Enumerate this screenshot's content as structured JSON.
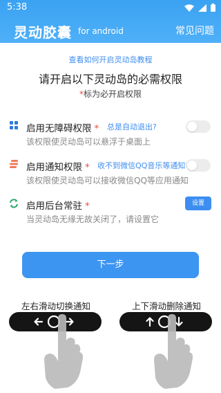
{
  "status": {
    "time": "5:38"
  },
  "header": {
    "title": "灵动胶囊",
    "subtitle": "for android",
    "faq": "常见问题"
  },
  "intro": {
    "tutorial_link": "查看如何开启灵动岛教程",
    "title": "请开启以下灵动岛的必需权限",
    "note_star": "*",
    "note": "标为必开启权限"
  },
  "permissions": [
    {
      "title": "启用无障碍权限",
      "star": "*",
      "help": "总是自动退出?",
      "desc": "该权限使灵动岛可以悬浮于桌面上",
      "control": "toggle",
      "enabled": false,
      "icon": "grid-icon",
      "icon_color": "#2f7bd9"
    },
    {
      "title": "启用通知权限",
      "star": "*",
      "help": "收不到微信QQ音乐等通知?",
      "desc": "该权限使灵动岛可以接收微信QQ等应用通知",
      "control": "toggle",
      "enabled": false,
      "icon": "stack-icon",
      "icon_color": "#f07b5a"
    },
    {
      "title": "启用后台常驻",
      "star": "*",
      "help": "",
      "desc": "当灵动岛无缘无故关闭了，请设置它",
      "control": "button",
      "button_label": "设置",
      "icon": "sync-icon",
      "icon_color": "#2ea86a"
    }
  ],
  "next_button": "下一步",
  "gestures": [
    {
      "label": "左右滑动切换通知",
      "icon_left": "left-arrow-icon",
      "icon_right": "right-arrow-icon"
    },
    {
      "label": "上下滑动删除通知",
      "icon_left": "up-arrow-icon",
      "icon_right": "down-arrow-icon"
    }
  ],
  "colors": {
    "accent": "#3d8ef0",
    "header": "#42a6f4",
    "required": "#e74c3c"
  }
}
